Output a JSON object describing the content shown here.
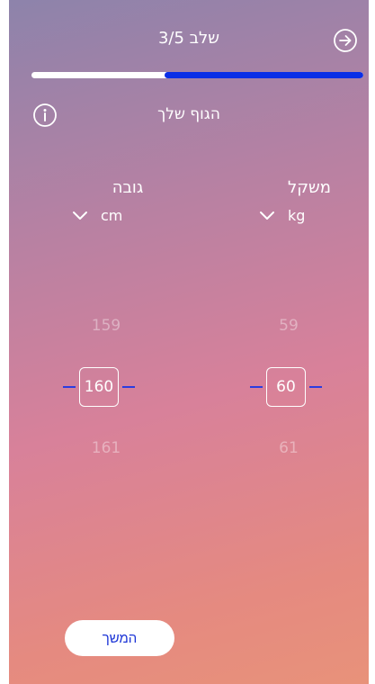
{
  "header": {
    "step_title": "שלב 3/5",
    "progress": 0.6,
    "accent_color": "#0a2ee6",
    "next_icon": "arrow-right-circle-icon"
  },
  "section": {
    "title": "הגוף שלך",
    "info_icon": "info-circle-icon"
  },
  "height": {
    "label": "גובה",
    "unit": "cm",
    "prev": "159",
    "selected": "160",
    "next": "161"
  },
  "weight": {
    "label": "משקל",
    "unit": "kg",
    "prev": "59",
    "selected": "60",
    "next": "61"
  },
  "footer": {
    "continue_label": "המשך"
  }
}
